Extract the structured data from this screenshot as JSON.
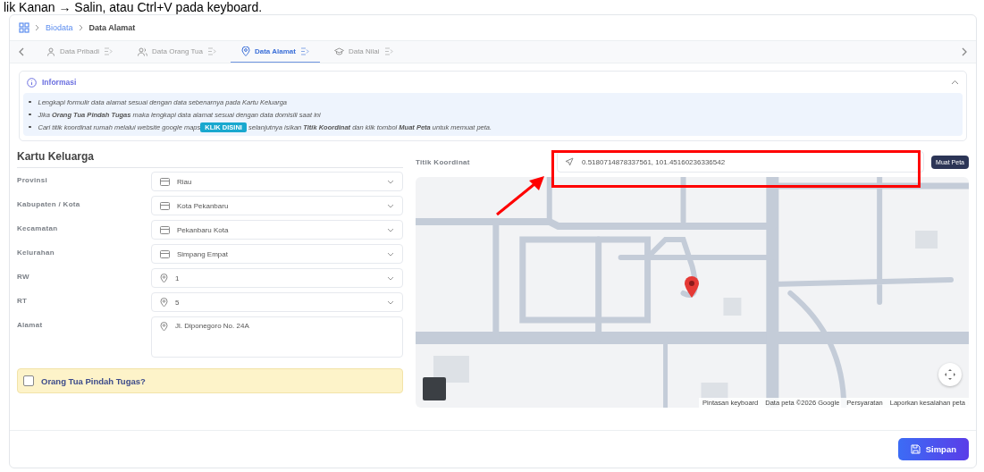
{
  "caption": "lik Kanan → Salin, atau Ctrl+V pada keyboard.",
  "breadcrumb": {
    "parent": "Biodata",
    "current": "Data Alamat"
  },
  "tabs": [
    {
      "label": "Data Pribadi",
      "selected": false
    },
    {
      "label": "Data Orang Tua",
      "selected": false
    },
    {
      "label": "Data Alamat",
      "selected": true
    },
    {
      "label": "Data Nilai",
      "selected": false
    }
  ],
  "info": {
    "title": "Informasi",
    "expanded": true,
    "items": [
      {
        "text": "Lengkapi formulir data alamat sesuai dengan data sebenarnya pada Kartu Keluarga"
      },
      {
        "text": "Jika **Orang Tua Pindah Tugas** maka lengkapi data alamat sesuai dengan data domisili saat ini"
      },
      {
        "text": "Cari titik koordinat rumah melalui website google maps",
        "link": "KLIK DISINI",
        "after": "selanjutnya isikan **Titik Koordinat** dan klik tombol **Muat Peta** untuk memuat peta."
      }
    ]
  },
  "form": {
    "title": "Kartu Keluarga",
    "fields": [
      {
        "label": "Provinsi",
        "kind": "region",
        "value": "Riau"
      },
      {
        "label": "Kabupaten / Kota",
        "kind": "region",
        "value": "Kota Pekanbaru"
      },
      {
        "label": "Kecamatan",
        "kind": "region",
        "value": "Pekanbaru Kota"
      },
      {
        "label": "Kelurahan",
        "kind": "region",
        "value": "Simpang Empat"
      },
      {
        "label": "RW",
        "kind": "number",
        "value": "1"
      },
      {
        "label": "RT",
        "kind": "number",
        "value": "5"
      },
      {
        "label": "Alamat",
        "kind": "textarea",
        "value": "Jl. Diponegoro No. 24A"
      }
    ]
  },
  "transfer": {
    "label": "Orang Tua Pindah Tugas?",
    "checked": false
  },
  "map": {
    "label": "Titik Koordinat",
    "value": "0.5180714878337561, 101.45160236336542",
    "button": "Muat Peta",
    "attribution": [
      "Pintasan keyboard",
      "Data peta ©2026 Google",
      "Persyaratan",
      "Laporkan kesalahan peta"
    ]
  },
  "save_button": "Simpan"
}
